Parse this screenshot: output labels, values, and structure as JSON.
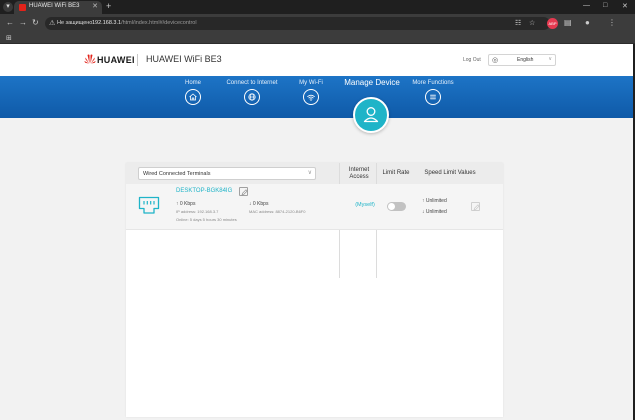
{
  "browser": {
    "tab_title": "HUAWEI WiFi BE3",
    "tab_chevron": "▾",
    "tab_close": "✕",
    "new_tab": "+",
    "window_controls": {
      "minimize": "—",
      "maximize": "□",
      "close": "✕"
    },
    "nav": {
      "back": "←",
      "forward": "→",
      "reload": "↻"
    },
    "security_icon": "⚠",
    "security_warning": "Не защищено",
    "url_host": "192.168.3.1",
    "url_path": "/html/index.html#/devicecontrol",
    "omnibox_icons": {
      "translate": "☷",
      "star": "☆"
    },
    "extension_badge": "ABP",
    "toolbar_icons": {
      "reader": "▤",
      "profile": "●",
      "menu": "⋮"
    },
    "apps_icon": "⊞"
  },
  "header": {
    "brand": "HUAWEI",
    "product": "HUAWEI WiFi BE3",
    "logout": "Log Out",
    "globe_icon": "◎",
    "language": "English",
    "chevron": "∨"
  },
  "nav": {
    "items": [
      {
        "label": "Home",
        "icon": "home-icon"
      },
      {
        "label": "Connect to Internet",
        "icon": "globe-icon"
      },
      {
        "label": "My Wi-Fi",
        "icon": "wifi-icon"
      },
      {
        "label": "Manage Device",
        "icon": "user-icon",
        "active": true
      },
      {
        "label": "More Functions",
        "icon": "menu-icon"
      }
    ]
  },
  "device_table": {
    "filter": {
      "value": "Wired Connected Terminals",
      "chevron": "∨"
    },
    "columns": {
      "internet_access": "Internet Access",
      "limit_rate": "Limit Rate",
      "speed_limit": "Speed Limit Values"
    },
    "rows": [
      {
        "name": "DESKTOP-BGK84IG",
        "upload": "↑ 0 Kbps",
        "download": "↓ 0 Kbps",
        "ip": "IP address: 192.168.3.7",
        "mac": "MAC address: 8874-2120-B6F0",
        "online": "Online: 5 days 5 hours 30 minutes",
        "internet_access": "(Myself)",
        "limit_rate_on": false,
        "speed_up": "↑ Unlimited",
        "speed_down": "↓ Unlimited",
        "icon": "ethernet-icon"
      }
    ]
  },
  "colors": {
    "accent": "#1fb4c8",
    "nav_band": "#1466b8",
    "brand_red": "#e2231a"
  }
}
